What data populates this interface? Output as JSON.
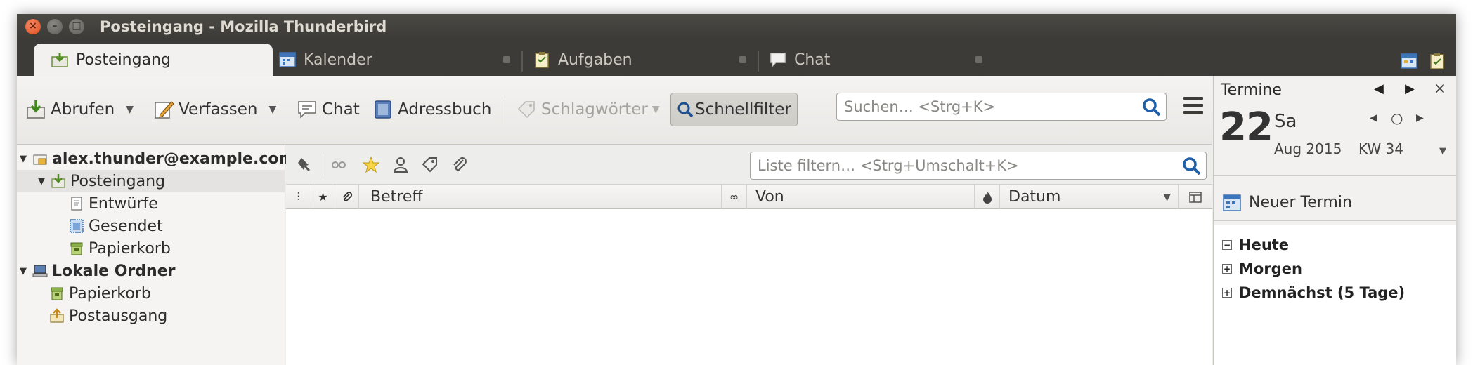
{
  "window": {
    "title": "Posteingang - Mozilla Thunderbird"
  },
  "tabs": [
    {
      "label": "Posteingang",
      "active": true,
      "icon": "inbox-icon"
    },
    {
      "label": "Kalender",
      "active": false,
      "icon": "calendar-icon"
    },
    {
      "label": "Aufgaben",
      "active": false,
      "icon": "tasks-icon"
    },
    {
      "label": "Chat",
      "active": false,
      "icon": "chat-icon"
    }
  ],
  "toolbar": {
    "get_messages": "Abrufen",
    "compose": "Verfassen",
    "chat": "Chat",
    "address_book": "Adressbuch",
    "tags": "Schlagwörter",
    "quick_filter": "Schnellfilter",
    "search_placeholder": "Suchen… <Strg+K>"
  },
  "folders": [
    {
      "label": "alex.thunder@example.com",
      "level": 0,
      "bold": true,
      "icon": "account-icon",
      "expanded": true
    },
    {
      "label": "Posteingang",
      "level": 1,
      "bold": false,
      "icon": "inbox-icon",
      "expanded": true,
      "selected": true
    },
    {
      "label": "Entwürfe",
      "level": 2,
      "bold": false,
      "icon": "drafts-icon"
    },
    {
      "label": "Gesendet",
      "level": 2,
      "bold": false,
      "icon": "sent-icon"
    },
    {
      "label": "Papierkorb",
      "level": 2,
      "bold": false,
      "icon": "trash-icon"
    },
    {
      "label": "Lokale Ordner",
      "level": 0,
      "bold": true,
      "icon": "local-folders-icon",
      "expanded": true
    },
    {
      "label": "Papierkorb",
      "level": 1,
      "bold": false,
      "icon": "trash-icon"
    },
    {
      "label": "Postausgang",
      "level": 1,
      "bold": false,
      "icon": "outbox-icon"
    }
  ],
  "filter": {
    "placeholder": "Liste filtern… <Strg+Umschalt+K>"
  },
  "columns": {
    "subject": "Betreff",
    "from": "Von",
    "date": "Datum"
  },
  "today_pane": {
    "title": "Termine",
    "day_number": "22",
    "day_name": "Sa",
    "month_year": "Aug 2015",
    "week": "KW 34",
    "new_event": "Neuer Termin",
    "agenda": [
      {
        "label": "Heute",
        "expanded": true
      },
      {
        "label": "Morgen",
        "expanded": false
      },
      {
        "label": "Demnächst (5 Tage)",
        "expanded": false
      }
    ]
  },
  "colors": {
    "titlebar": "#3c3b37",
    "active_tab": "#f2f1f0",
    "toolbar": "#ededeb",
    "close_button": "#df4a1a",
    "search_icon": "#1e5fa8"
  }
}
